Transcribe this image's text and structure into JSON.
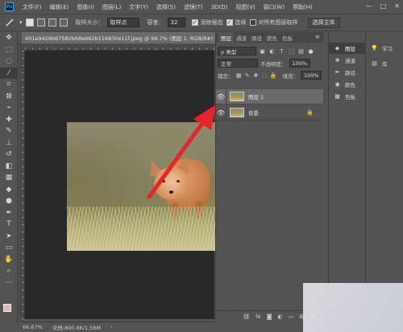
{
  "app": {
    "logo": "Ps"
  },
  "menu": [
    "文件(F)",
    "编辑(E)",
    "图像(I)",
    "图层(L)",
    "文字(Y)",
    "选择(S)",
    "滤镜(T)",
    "3D(D)",
    "视图(V)",
    "窗口(W)",
    "帮助(H)"
  ],
  "window_controls": {
    "minimize": "—",
    "maximize": "□",
    "close": "✕"
  },
  "options": {
    "sample_size_label": "取样大小：",
    "sample_size_value": "取样点",
    "tolerance_label": "容差：",
    "tolerance_value": "32",
    "antialias_label": "消除锯齿",
    "contiguous_label": "连续",
    "sample_all_label": "对所有图层取样",
    "select_subject_label": "选择主体"
  },
  "document": {
    "tab_title": "401e9428b67582b68e662b116830e11f.jpeg @ 66.7% (图层 1, RGB/8#) *",
    "close": "×"
  },
  "layers_panel": {
    "tabs": [
      "图层",
      "通道",
      "路径",
      "颜色",
      "色板"
    ],
    "menu_icon": "≡",
    "filter_kind": "ρ 类型",
    "blend_mode": "正常",
    "opacity_label": "不透明度：",
    "opacity_value": "100%",
    "lock_label": "锁定：",
    "fill_label": "填充：",
    "fill_value": "100%",
    "layers": [
      {
        "name": "图层 1",
        "selected": true
      },
      {
        "name": "背景",
        "selected": false,
        "locked": true
      }
    ],
    "footer_icons": [
      "link-icon",
      "fx-icon",
      "mask-icon",
      "adjustment-icon",
      "group-icon",
      "new-layer-icon",
      "trash-icon"
    ]
  },
  "side_panels": {
    "items": [
      "图层",
      "通道",
      "路径",
      "颜色",
      "色板"
    ],
    "items2": [
      "学习",
      "库"
    ]
  },
  "status": {
    "zoom": "66.67%",
    "doc": "文档:800.6K/1.56M",
    "arrow": "›"
  },
  "colors": {
    "foreground": "#e8b7b7",
    "background": "#ffffff",
    "arrow": "#e8232a"
  }
}
